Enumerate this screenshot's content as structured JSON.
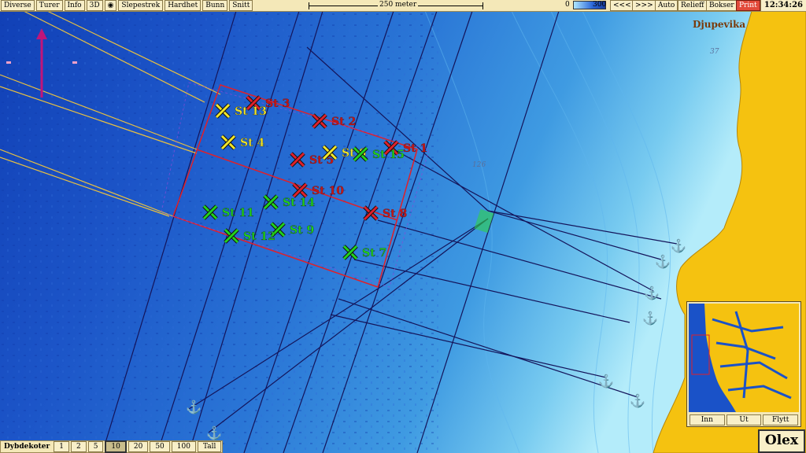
{
  "toolbar": {
    "menu": [
      "Diverse",
      "Turer",
      "Info",
      "3D",
      "Slepestrek",
      "Hardhet",
      "Bunn",
      "Snitt"
    ],
    "scale_label": "250 meter",
    "depth_min": "0",
    "depth_max": "300",
    "nav_back": "<<<",
    "nav_forward": ">>>",
    "right_buttons": [
      "Auto",
      "Relieff",
      "Bokser"
    ],
    "print_label": "Print",
    "clock": "12:34:26"
  },
  "map": {
    "place_name": "Djupevika",
    "depth_labels": [
      {
        "text": "37",
        "key": "a"
      },
      {
        "text": "126",
        "key": "b"
      }
    ]
  },
  "stations": [
    {
      "label": "St 1",
      "color": "red",
      "lx": "490",
      "ly": "187"
    },
    {
      "label": "St 2",
      "color": "red"
    },
    {
      "label": "St 3",
      "color": "red"
    },
    {
      "label": "St 4",
      "color": "yellow"
    },
    {
      "label": "St 5",
      "color": "red"
    },
    {
      "label": "St 6",
      "color": "yellow"
    },
    {
      "label": "St 7",
      "color": "green"
    },
    {
      "label": "St 8",
      "color": "red"
    },
    {
      "label": "St 9",
      "color": "green"
    },
    {
      "label": "St 10",
      "color": "red"
    },
    {
      "label": "St 11",
      "color": "green"
    },
    {
      "label": "St 12",
      "color": "green"
    },
    {
      "label": "St 13",
      "color": "yellow"
    },
    {
      "label": "St 14",
      "color": "green"
    },
    {
      "label": "St 15",
      "color": "green"
    }
  ],
  "bottom": {
    "label": "Dybdekoter",
    "options": [
      "1",
      "2",
      "5",
      "10",
      "20",
      "50",
      "100",
      "Tall"
    ],
    "selected": "10"
  },
  "inset": {
    "buttons": [
      "Inn",
      "Ut",
      "Flytt"
    ]
  },
  "logo": "Olex",
  "colors": {
    "deep_water": "#1a4fc0",
    "shallow_water": "#8fe0f6",
    "land": "#f5c210",
    "box": "#e0202a",
    "cross_red": "#e0202a",
    "cross_yellow": "#f2e62a",
    "cross_green": "#22d21c",
    "track_dark": "#14145a",
    "track_yellow": "#e8c040"
  }
}
